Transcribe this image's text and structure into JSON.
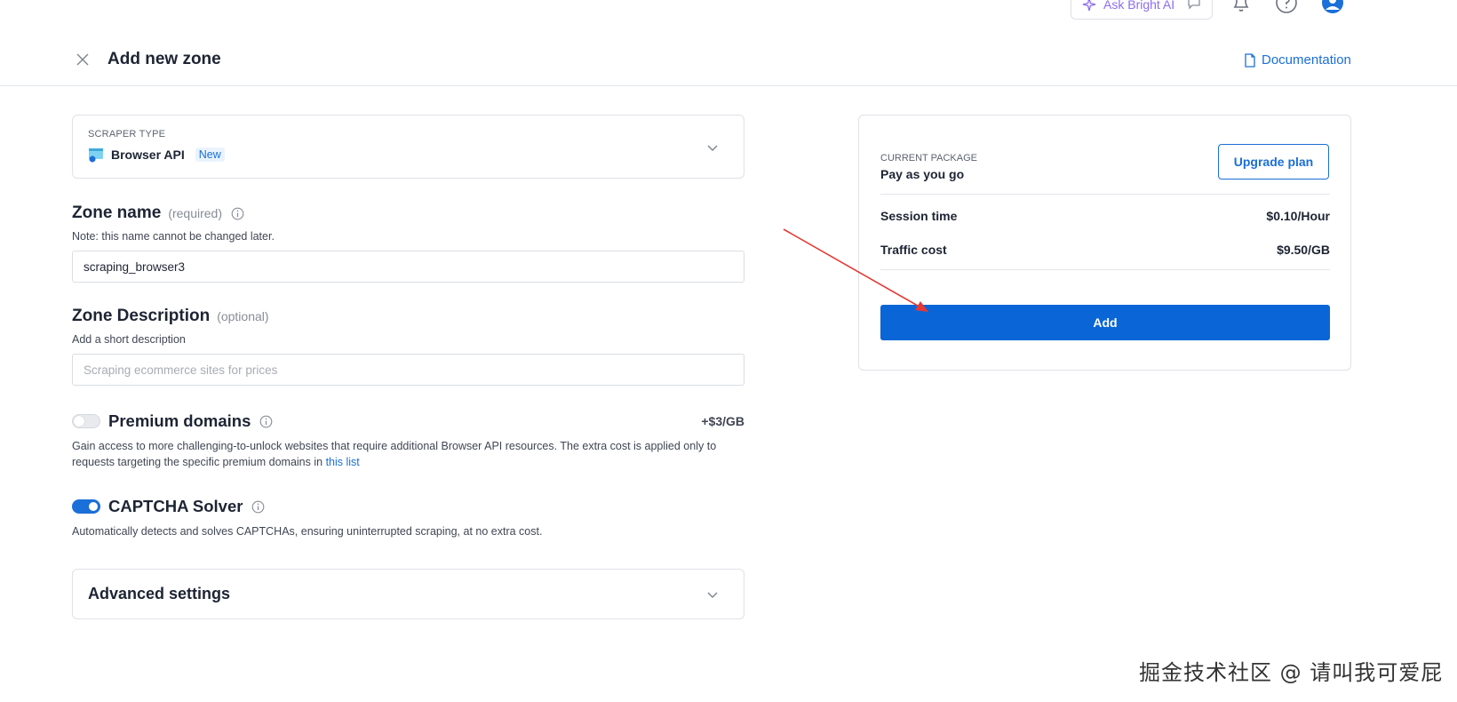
{
  "topbar": {
    "ask_ai_label": "Ask Bright AI",
    "icons": [
      "sparkle-icon",
      "chat-icon",
      "bell-icon",
      "help-icon",
      "user-icon"
    ]
  },
  "header": {
    "title": "Add new zone",
    "documentation_label": "Documentation"
  },
  "scraper": {
    "label": "SCRAPER TYPE",
    "value": "Browser API",
    "badge": "New"
  },
  "zone_name": {
    "title": "Zone name",
    "qualifier": "(required)",
    "note": "Note: this name cannot be changed later.",
    "value": "scraping_browser3"
  },
  "zone_description": {
    "title": "Zone Description",
    "qualifier": "(optional)",
    "note": "Add a short description",
    "placeholder": "Scraping ecommerce sites for prices"
  },
  "premium": {
    "title": "Premium domains",
    "price": "+$3/GB",
    "enabled": false,
    "desc": "Gain access to more challenging-to-unlock websites that require additional Browser API resources. The extra cost is applied only to requests targeting the specific premium domains in",
    "link": "this list"
  },
  "captcha": {
    "title": "CAPTCHA Solver",
    "enabled": true,
    "desc": "Automatically detects and solves CAPTCHAs, ensuring uninterrupted scraping, at no extra cost."
  },
  "advanced": {
    "title": "Advanced settings"
  },
  "package": {
    "label": "CURRENT PACKAGE",
    "value": "Pay as you go",
    "upgrade_label": "Upgrade plan",
    "rows": [
      {
        "label": "Session time",
        "value": "$0.10/Hour"
      },
      {
        "label": "Traffic cost",
        "value": "$9.50/GB"
      }
    ],
    "add_label": "Add"
  },
  "colors": {
    "accent": "#1a6fd8",
    "primary_button": "#0a66d6",
    "ai_purple": "#8b6cf1",
    "annotation_arrow": "#e53935"
  },
  "watermark": "掘金技术社区 @ 请叫我可爱屁"
}
